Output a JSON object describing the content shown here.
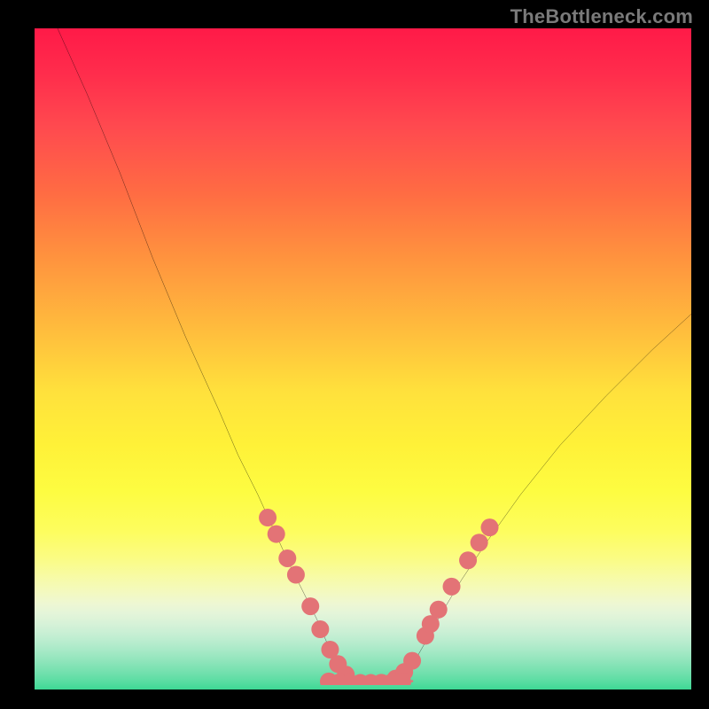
{
  "watermark": "TheBottleneck.com",
  "chart_data": {
    "type": "line",
    "title": "",
    "xlabel": "",
    "ylabel": "",
    "xlim": [
      0,
      100
    ],
    "ylim": [
      0,
      100
    ],
    "gradient_stops": [
      {
        "pos": 0,
        "color": "#ff1a48"
      },
      {
        "pos": 25,
        "color": "#ff6c43"
      },
      {
        "pos": 50,
        "color": "#ffd13c"
      },
      {
        "pos": 70,
        "color": "#fdfc41"
      },
      {
        "pos": 85,
        "color": "#f3f9c2"
      },
      {
        "pos": 100,
        "color": "#3dd894"
      }
    ],
    "series": [
      {
        "name": "left-curve",
        "x": [
          3.5,
          8,
          13,
          18,
          23,
          28,
          31,
          34,
          36.5,
          39,
          41,
          43,
          44.5,
          46,
          47.2,
          48.2
        ],
        "y": [
          100,
          90,
          78,
          65,
          53,
          42,
          35,
          29,
          23.5,
          18,
          14,
          10,
          6.5,
          3.5,
          1.5,
          0.5
        ]
      },
      {
        "name": "right-curve",
        "x": [
          54.5,
          56,
          57.5,
          59.5,
          62,
          65,
          69,
          74,
          80,
          87,
          94,
          100
        ],
        "y": [
          0.5,
          1.3,
          3,
          6.5,
          11,
          16,
          22,
          29,
          36.5,
          44,
          51,
          56.5
        ]
      },
      {
        "name": "valley-floor",
        "x": [
          44.2,
          46,
          48,
          50,
          52,
          54,
          56,
          57.5
        ],
        "y": [
          0.6,
          0.35,
          0.25,
          0.25,
          0.25,
          0.25,
          0.35,
          0.6
        ]
      }
    ],
    "highlight_points_left": [
      {
        "x": 35.5,
        "y": 25.5
      },
      {
        "x": 36.8,
        "y": 23.0
      },
      {
        "x": 38.5,
        "y": 19.3
      },
      {
        "x": 39.8,
        "y": 16.8
      },
      {
        "x": 42.0,
        "y": 12.0
      },
      {
        "x": 43.5,
        "y": 8.5
      },
      {
        "x": 45.0,
        "y": 5.4
      },
      {
        "x": 46.2,
        "y": 3.2
      },
      {
        "x": 47.4,
        "y": 1.6
      }
    ],
    "highlight_points_right": [
      {
        "x": 55.0,
        "y": 1.0
      },
      {
        "x": 56.3,
        "y": 2.0
      },
      {
        "x": 57.5,
        "y": 3.7
      },
      {
        "x": 59.5,
        "y": 7.5
      },
      {
        "x": 60.3,
        "y": 9.3
      },
      {
        "x": 61.5,
        "y": 11.5
      },
      {
        "x": 63.5,
        "y": 15.0
      },
      {
        "x": 66.0,
        "y": 19.0
      },
      {
        "x": 67.7,
        "y": 21.7
      },
      {
        "x": 69.3,
        "y": 24.0
      }
    ],
    "highlight_points_bottom": [
      {
        "x": 44.8,
        "y": 0.55
      },
      {
        "x": 46.4,
        "y": 0.4
      },
      {
        "x": 48.0,
        "y": 0.35
      },
      {
        "x": 49.6,
        "y": 0.33
      },
      {
        "x": 51.2,
        "y": 0.33
      },
      {
        "x": 52.8,
        "y": 0.35
      },
      {
        "x": 54.4,
        "y": 0.4
      },
      {
        "x": 56.0,
        "y": 0.5
      }
    ],
    "dot_radius": 1.35,
    "dot_color": "#e37376",
    "valley_stroke_color": "#e37376",
    "valley_stroke_width": 2.5,
    "curve_stroke_color": "#000000",
    "curve_stroke_width": 0.3
  }
}
